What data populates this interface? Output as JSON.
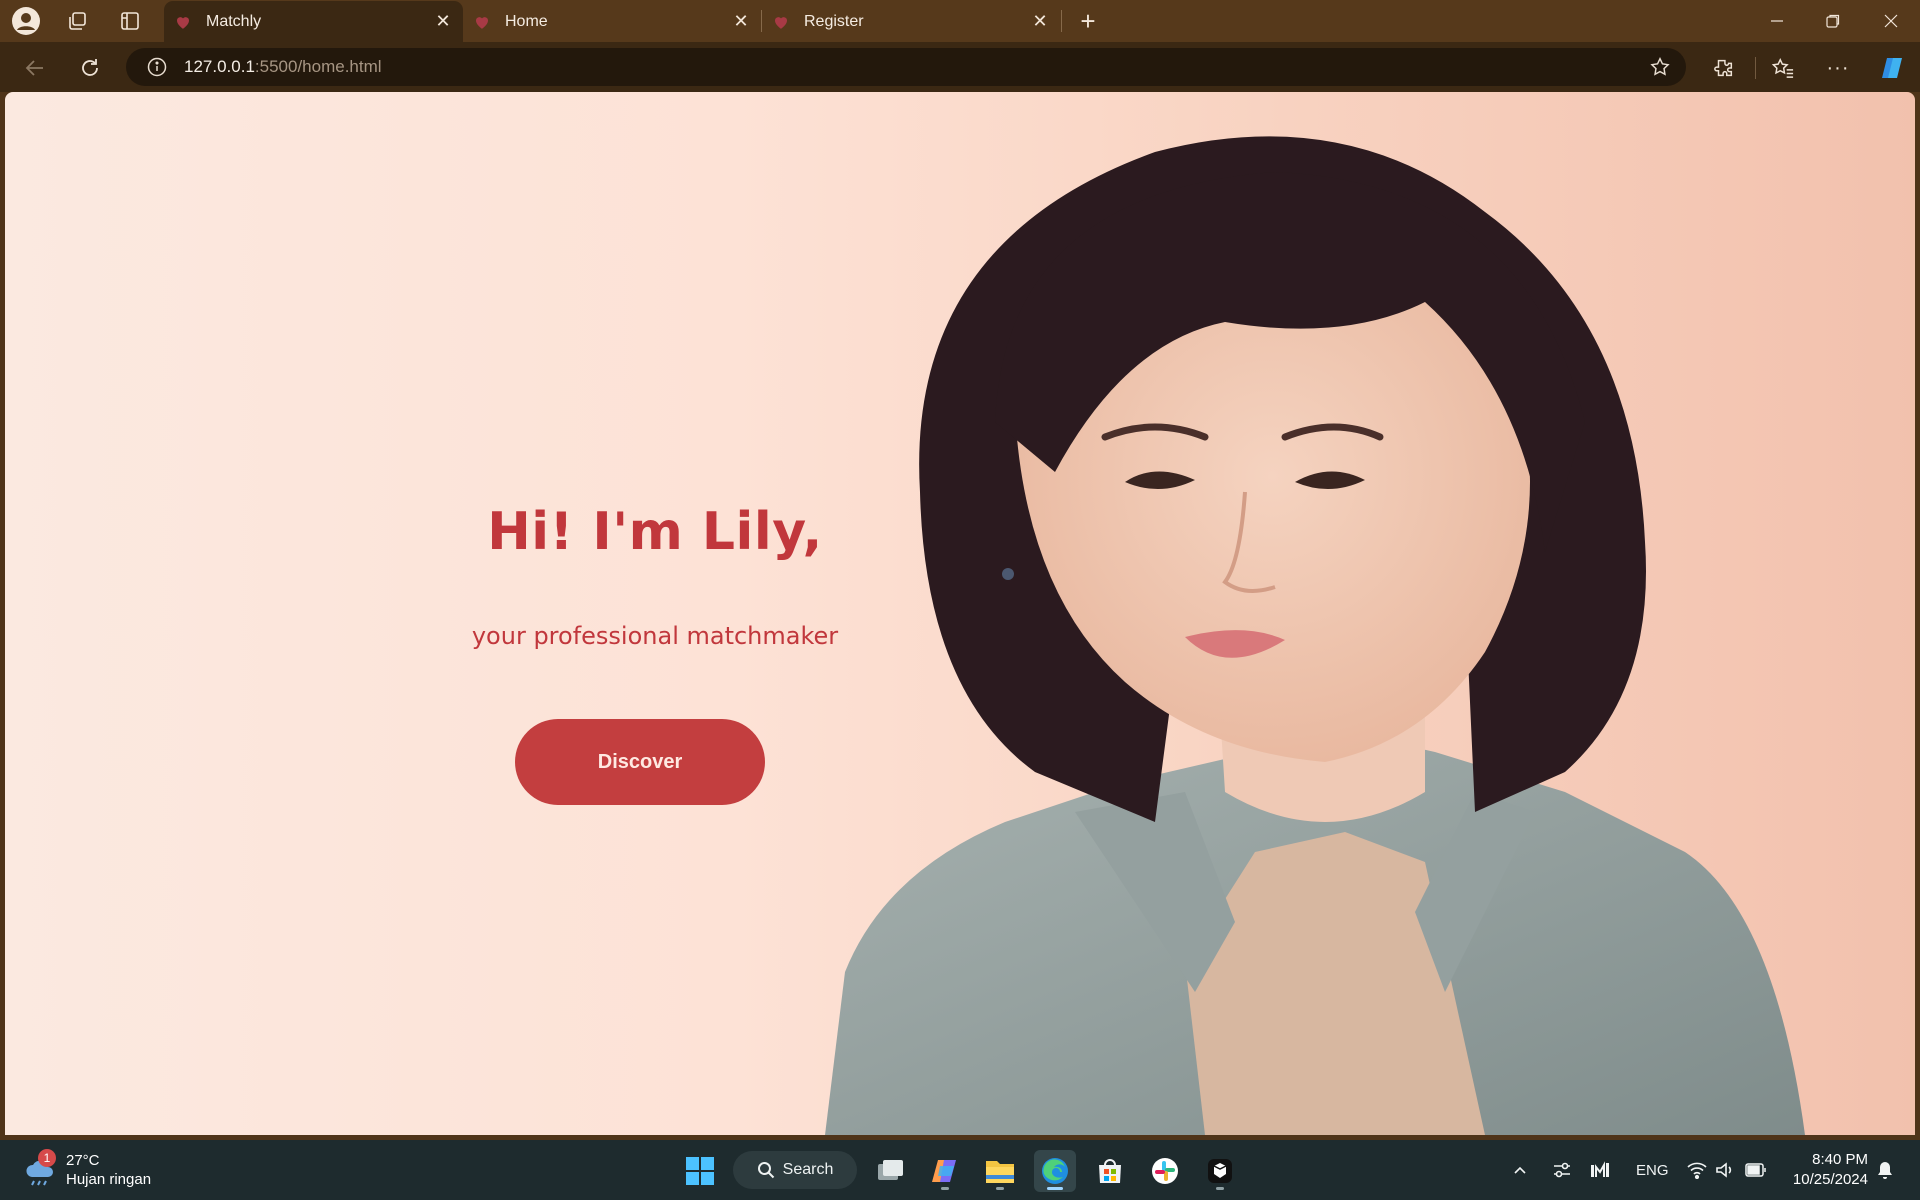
{
  "browser": {
    "tabs": [
      {
        "title": "Matchly",
        "active": true
      },
      {
        "title": "Home",
        "active": false
      },
      {
        "title": "Register",
        "active": false
      }
    ],
    "address": {
      "host": "127.0.0.1",
      "path": ":5500/home.html"
    }
  },
  "page": {
    "title": "Hi! I'm Lily,",
    "subtitle": "your professional matchmaker",
    "cta_label": "Discover",
    "colors": {
      "accent": "#c1373c",
      "button": "#c33e3f",
      "background": "#fde2d6"
    }
  },
  "taskbar": {
    "weather": {
      "temp": "27°C",
      "desc": "Hujan ringan",
      "badge": "1"
    },
    "search_label": "Search",
    "language": "ENG",
    "time": "8:40 PM",
    "date": "10/25/2024"
  }
}
